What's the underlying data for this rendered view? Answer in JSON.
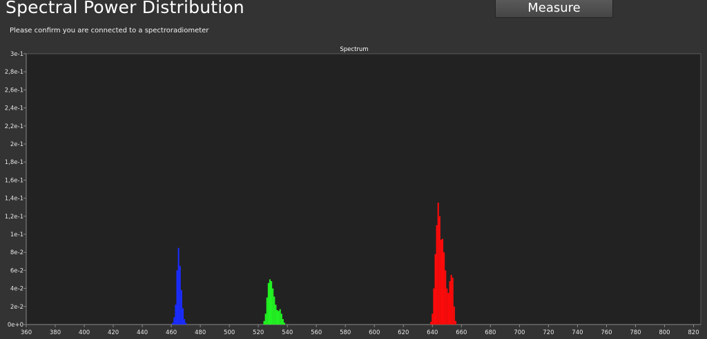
{
  "header": {
    "title": "Spectral Power Distribution",
    "measure_label": "Measure",
    "status_text": "Please confirm you are connected to a spectroradiometer"
  },
  "chart_data": {
    "type": "bar",
    "title": "Spectrum",
    "xlim": [
      360,
      825
    ],
    "ylim": [
      0,
      0.3
    ],
    "grid": false,
    "x_ticks": [
      360,
      380,
      400,
      420,
      440,
      460,
      480,
      500,
      520,
      540,
      560,
      580,
      600,
      620,
      640,
      660,
      680,
      700,
      720,
      740,
      760,
      780,
      800,
      820
    ],
    "y_ticks": [
      {
        "value": 0.3,
        "label": "3e-1"
      },
      {
        "value": 0.28,
        "label": "2,8e-1"
      },
      {
        "value": 0.26,
        "label": "2,6e-1"
      },
      {
        "value": 0.24,
        "label": "2,4e-1"
      },
      {
        "value": 0.22,
        "label": "2,2e-1"
      },
      {
        "value": 0.2,
        "label": "2e-1"
      },
      {
        "value": 0.18,
        "label": "1,8e-1"
      },
      {
        "value": 0.16,
        "label": "1,6e-1"
      },
      {
        "value": 0.14,
        "label": "1,4e-1"
      },
      {
        "value": 0.12,
        "label": "1,2e-1"
      },
      {
        "value": 0.1,
        "label": "1e-1"
      },
      {
        "value": 0.08,
        "label": "8e-2"
      },
      {
        "value": 0.06,
        "label": "6e-2"
      },
      {
        "value": 0.04,
        "label": "4e-2"
      },
      {
        "value": 0.02,
        "label": "2e-2"
      },
      {
        "value": 0.0,
        "label": "0e+0"
      }
    ],
    "series": [
      {
        "color": "#1a2cff",
        "x": [
          461,
          462,
          463,
          464,
          465,
          466,
          467,
          468,
          469,
          470
        ],
        "values": [
          0.002,
          0.008,
          0.022,
          0.06,
          0.085,
          0.065,
          0.038,
          0.018,
          0.006,
          0.002
        ]
      },
      {
        "color": "#22f522",
        "x": [
          524,
          525,
          526,
          527,
          528,
          529,
          530,
          531,
          532,
          533,
          534,
          535,
          536,
          537,
          538
        ],
        "values": [
          0.004,
          0.012,
          0.03,
          0.046,
          0.05,
          0.048,
          0.04,
          0.031,
          0.022,
          0.016,
          0.015,
          0.017,
          0.012,
          0.006,
          0.002
        ]
      },
      {
        "color": "#ff0a0a",
        "x": [
          639,
          640,
          641,
          642,
          643,
          644,
          645,
          646,
          647,
          648,
          649,
          650,
          651,
          652,
          653,
          654,
          655,
          656
        ],
        "values": [
          0.003,
          0.012,
          0.04,
          0.078,
          0.11,
          0.135,
          0.12,
          0.094,
          0.095,
          0.08,
          0.06,
          0.04,
          0.035,
          0.048,
          0.055,
          0.052,
          0.02,
          0.004
        ]
      }
    ]
  }
}
